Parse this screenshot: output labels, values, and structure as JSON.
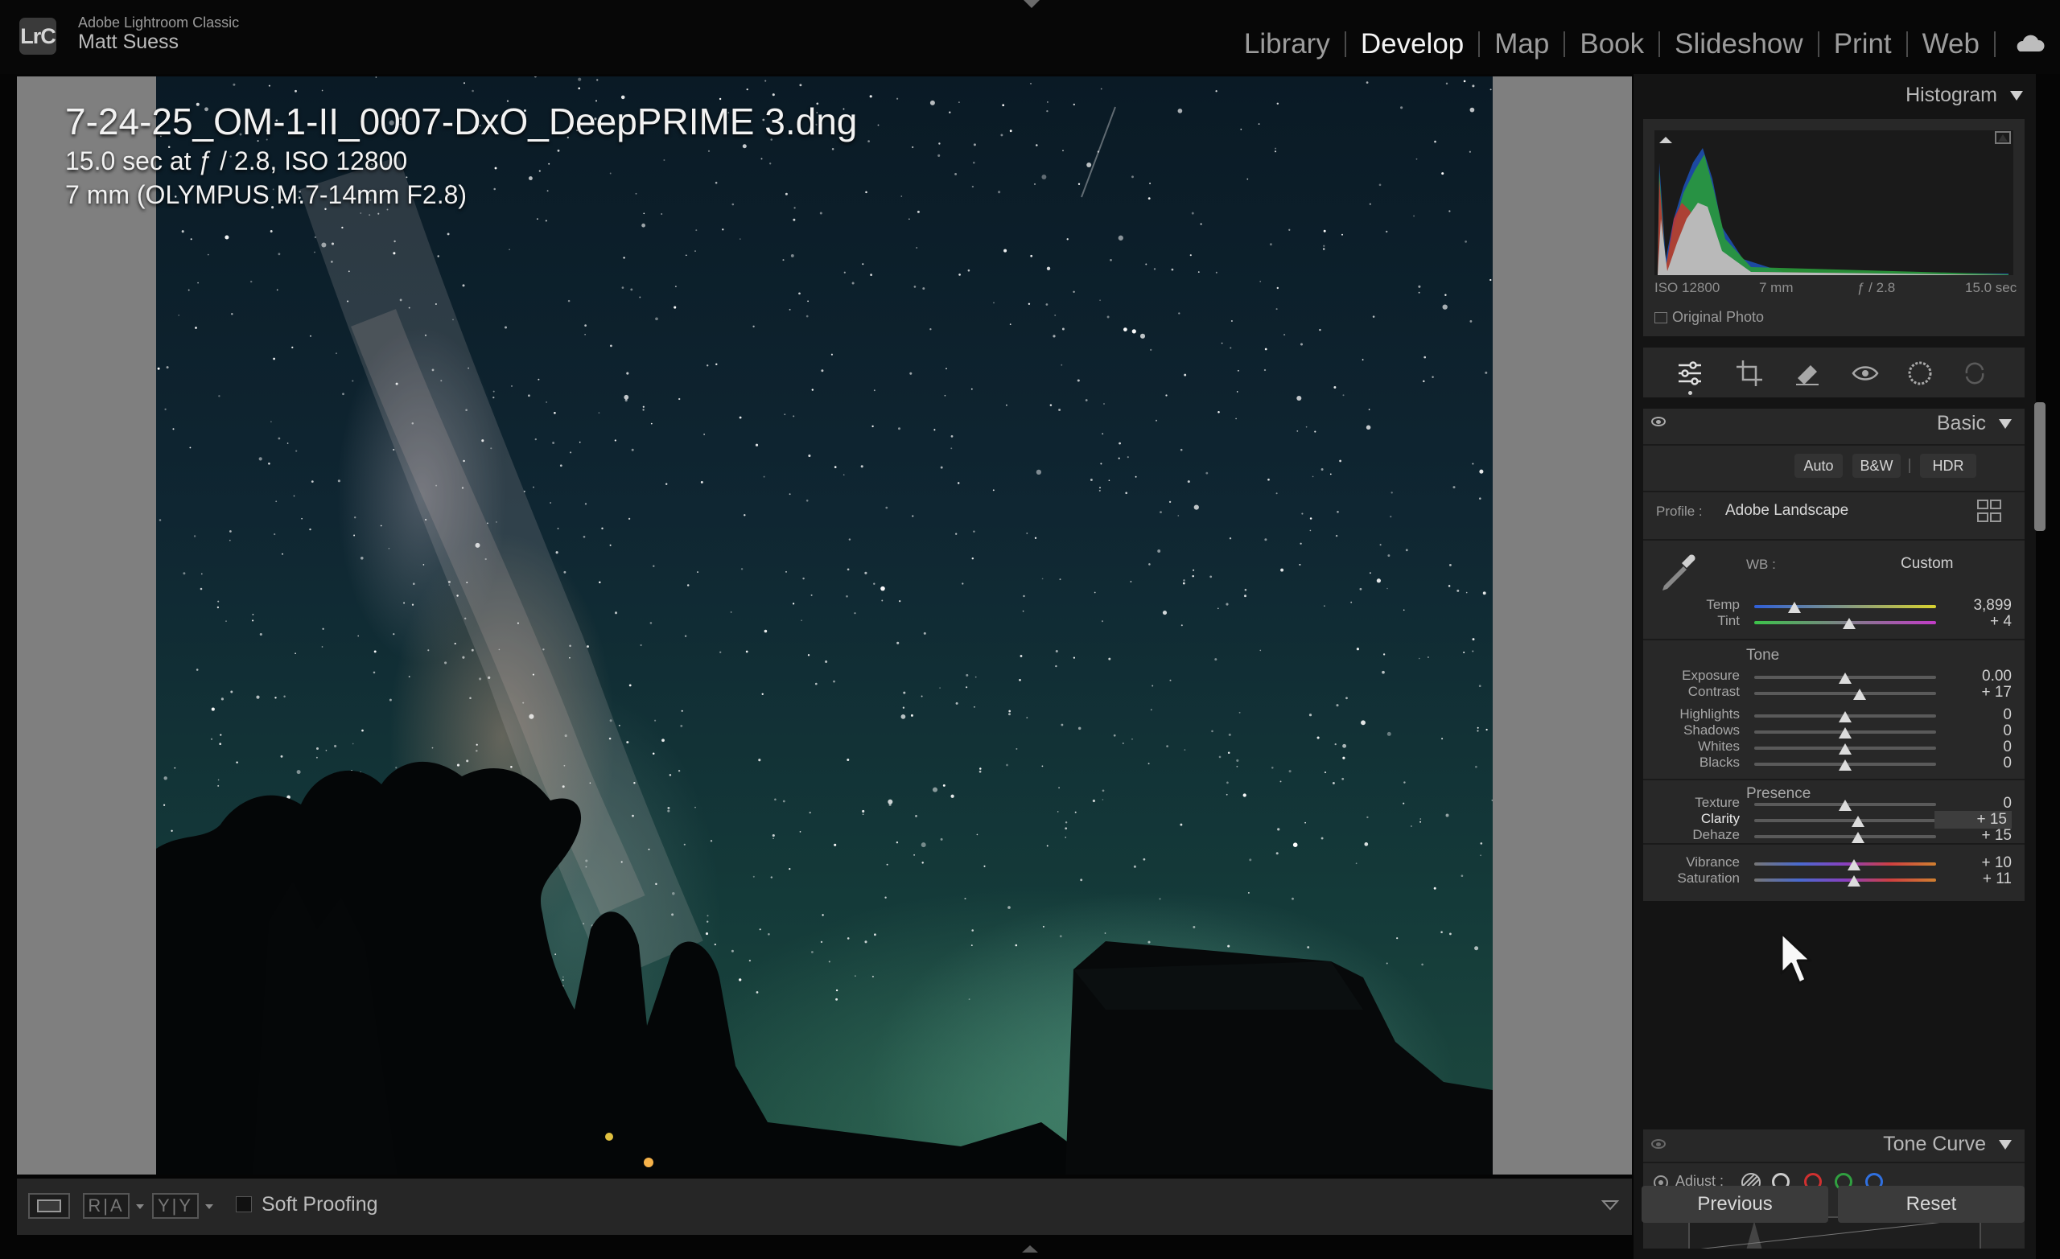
{
  "app": {
    "product": "Adobe Lightroom Classic",
    "user": "Matt Suess",
    "logo": "LrC"
  },
  "modules": [
    {
      "label": "Library",
      "active": false
    },
    {
      "label": "Develop",
      "active": true
    },
    {
      "label": "Map",
      "active": false
    },
    {
      "label": "Book",
      "active": false
    },
    {
      "label": "Slideshow",
      "active": false
    },
    {
      "label": "Print",
      "active": false
    },
    {
      "label": "Web",
      "active": false
    }
  ],
  "photo_info": {
    "filename": "7-24-25_OM-1-II_0007-DxO_DeepPRIME 3.dng",
    "exposure": "15.0 sec at ƒ / 2.8, ISO 12800",
    "lens": "7 mm (OLYMPUS M.7-14mm F2.8)"
  },
  "toolbar": {
    "ra_label": "R|A",
    "yy_label": "Y|Y",
    "soft_proofing": "Soft Proofing"
  },
  "histogram": {
    "title": "Histogram",
    "iso": "ISO 12800",
    "focal": "7 mm",
    "aperture": "ƒ / 2.8",
    "shutter": "15.0 sec",
    "original_photo": "Original Photo"
  },
  "basic": {
    "title": "Basic",
    "auto": "Auto",
    "bw": "B&W",
    "hdr": "HDR",
    "profile_label": "Profile :",
    "profile_value": "Adobe Landscape",
    "wb_label": "WB :",
    "wb_value": "Custom",
    "tone_title": "Tone",
    "presence_title": "Presence",
    "sliders": {
      "temp": {
        "label": "Temp",
        "value": "3,899",
        "pos": 0.22
      },
      "tint": {
        "label": "Tint",
        "value": "+ 4",
        "pos": 0.52
      },
      "exposure": {
        "label": "Exposure",
        "value": "0.00",
        "pos": 0.5
      },
      "contrast": {
        "label": "Contrast",
        "value": "+ 17",
        "pos": 0.58
      },
      "highlights": {
        "label": "Highlights",
        "value": "0",
        "pos": 0.5
      },
      "shadows": {
        "label": "Shadows",
        "value": "0",
        "pos": 0.5
      },
      "whites": {
        "label": "Whites",
        "value": "0",
        "pos": 0.5
      },
      "blacks": {
        "label": "Blacks",
        "value": "0",
        "pos": 0.5
      },
      "texture": {
        "label": "Texture",
        "value": "0",
        "pos": 0.5
      },
      "clarity": {
        "label": "Clarity",
        "value": "+ 15",
        "pos": 0.57
      },
      "dehaze": {
        "label": "Dehaze",
        "value": "+ 15",
        "pos": 0.57
      },
      "vibrance": {
        "label": "Vibrance",
        "value": "+ 10",
        "pos": 0.55
      },
      "saturation": {
        "label": "Saturation",
        "value": "+ 11",
        "pos": 0.55
      }
    }
  },
  "tone_curve": {
    "title": "Tone Curve",
    "adjust_label": "Adjust :"
  },
  "buttons": {
    "previous": "Previous",
    "reset": "Reset"
  },
  "colors": {
    "temp_track_start": "#2f5fd8",
    "temp_track_end": "#d8d22f",
    "tint_track_start": "#3cc34a",
    "tint_track_end": "#c23cc7"
  }
}
